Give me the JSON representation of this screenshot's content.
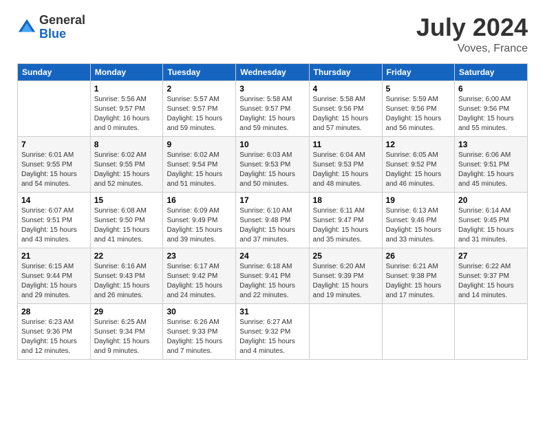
{
  "logo": {
    "general": "General",
    "blue": "Blue"
  },
  "title": "July 2024",
  "subtitle": "Voves, France",
  "days_of_week": [
    "Sunday",
    "Monday",
    "Tuesday",
    "Wednesday",
    "Thursday",
    "Friday",
    "Saturday"
  ],
  "weeks": [
    [
      {
        "num": "",
        "info": ""
      },
      {
        "num": "1",
        "info": "Sunrise: 5:56 AM\nSunset: 9:57 PM\nDaylight: 16 hours\nand 0 minutes."
      },
      {
        "num": "2",
        "info": "Sunrise: 5:57 AM\nSunset: 9:57 PM\nDaylight: 15 hours\nand 59 minutes."
      },
      {
        "num": "3",
        "info": "Sunrise: 5:58 AM\nSunset: 9:57 PM\nDaylight: 15 hours\nand 59 minutes."
      },
      {
        "num": "4",
        "info": "Sunrise: 5:58 AM\nSunset: 9:56 PM\nDaylight: 15 hours\nand 57 minutes."
      },
      {
        "num": "5",
        "info": "Sunrise: 5:59 AM\nSunset: 9:56 PM\nDaylight: 15 hours\nand 56 minutes."
      },
      {
        "num": "6",
        "info": "Sunrise: 6:00 AM\nSunset: 9:56 PM\nDaylight: 15 hours\nand 55 minutes."
      }
    ],
    [
      {
        "num": "7",
        "info": "Sunrise: 6:01 AM\nSunset: 9:55 PM\nDaylight: 15 hours\nand 54 minutes."
      },
      {
        "num": "8",
        "info": "Sunrise: 6:02 AM\nSunset: 9:55 PM\nDaylight: 15 hours\nand 52 minutes."
      },
      {
        "num": "9",
        "info": "Sunrise: 6:02 AM\nSunset: 9:54 PM\nDaylight: 15 hours\nand 51 minutes."
      },
      {
        "num": "10",
        "info": "Sunrise: 6:03 AM\nSunset: 9:53 PM\nDaylight: 15 hours\nand 50 minutes."
      },
      {
        "num": "11",
        "info": "Sunrise: 6:04 AM\nSunset: 9:53 PM\nDaylight: 15 hours\nand 48 minutes."
      },
      {
        "num": "12",
        "info": "Sunrise: 6:05 AM\nSunset: 9:52 PM\nDaylight: 15 hours\nand 46 minutes."
      },
      {
        "num": "13",
        "info": "Sunrise: 6:06 AM\nSunset: 9:51 PM\nDaylight: 15 hours\nand 45 minutes."
      }
    ],
    [
      {
        "num": "14",
        "info": "Sunrise: 6:07 AM\nSunset: 9:51 PM\nDaylight: 15 hours\nand 43 minutes."
      },
      {
        "num": "15",
        "info": "Sunrise: 6:08 AM\nSunset: 9:50 PM\nDaylight: 15 hours\nand 41 minutes."
      },
      {
        "num": "16",
        "info": "Sunrise: 6:09 AM\nSunset: 9:49 PM\nDaylight: 15 hours\nand 39 minutes."
      },
      {
        "num": "17",
        "info": "Sunrise: 6:10 AM\nSunset: 9:48 PM\nDaylight: 15 hours\nand 37 minutes."
      },
      {
        "num": "18",
        "info": "Sunrise: 6:11 AM\nSunset: 9:47 PM\nDaylight: 15 hours\nand 35 minutes."
      },
      {
        "num": "19",
        "info": "Sunrise: 6:13 AM\nSunset: 9:46 PM\nDaylight: 15 hours\nand 33 minutes."
      },
      {
        "num": "20",
        "info": "Sunrise: 6:14 AM\nSunset: 9:45 PM\nDaylight: 15 hours\nand 31 minutes."
      }
    ],
    [
      {
        "num": "21",
        "info": "Sunrise: 6:15 AM\nSunset: 9:44 PM\nDaylight: 15 hours\nand 29 minutes."
      },
      {
        "num": "22",
        "info": "Sunrise: 6:16 AM\nSunset: 9:43 PM\nDaylight: 15 hours\nand 26 minutes."
      },
      {
        "num": "23",
        "info": "Sunrise: 6:17 AM\nSunset: 9:42 PM\nDaylight: 15 hours\nand 24 minutes."
      },
      {
        "num": "24",
        "info": "Sunrise: 6:18 AM\nSunset: 9:41 PM\nDaylight: 15 hours\nand 22 minutes."
      },
      {
        "num": "25",
        "info": "Sunrise: 6:20 AM\nSunset: 9:39 PM\nDaylight: 15 hours\nand 19 minutes."
      },
      {
        "num": "26",
        "info": "Sunrise: 6:21 AM\nSunset: 9:38 PM\nDaylight: 15 hours\nand 17 minutes."
      },
      {
        "num": "27",
        "info": "Sunrise: 6:22 AM\nSunset: 9:37 PM\nDaylight: 15 hours\nand 14 minutes."
      }
    ],
    [
      {
        "num": "28",
        "info": "Sunrise: 6:23 AM\nSunset: 9:36 PM\nDaylight: 15 hours\nand 12 minutes."
      },
      {
        "num": "29",
        "info": "Sunrise: 6:25 AM\nSunset: 9:34 PM\nDaylight: 15 hours\nand 9 minutes."
      },
      {
        "num": "30",
        "info": "Sunrise: 6:26 AM\nSunset: 9:33 PM\nDaylight: 15 hours\nand 7 minutes."
      },
      {
        "num": "31",
        "info": "Sunrise: 6:27 AM\nSunset: 9:32 PM\nDaylight: 15 hours\nand 4 minutes."
      },
      {
        "num": "",
        "info": ""
      },
      {
        "num": "",
        "info": ""
      },
      {
        "num": "",
        "info": ""
      }
    ]
  ]
}
